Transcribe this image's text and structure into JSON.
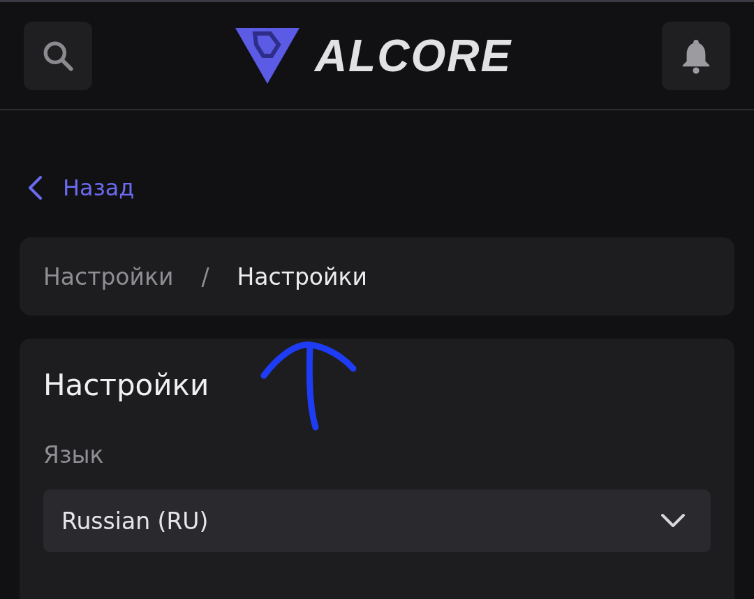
{
  "header": {
    "logo_text": "ALCORE"
  },
  "back_link": {
    "label": "Назад"
  },
  "breadcrumb": [
    {
      "label": "Настройки",
      "kind": "link",
      "current": false
    },
    {
      "label": "/",
      "kind": "separator"
    },
    {
      "label": "Настройки",
      "kind": "link",
      "current": true
    }
  ],
  "settings": {
    "title": "Настройки",
    "language": {
      "label": "Язык",
      "value": "Russian (RU)"
    }
  }
}
